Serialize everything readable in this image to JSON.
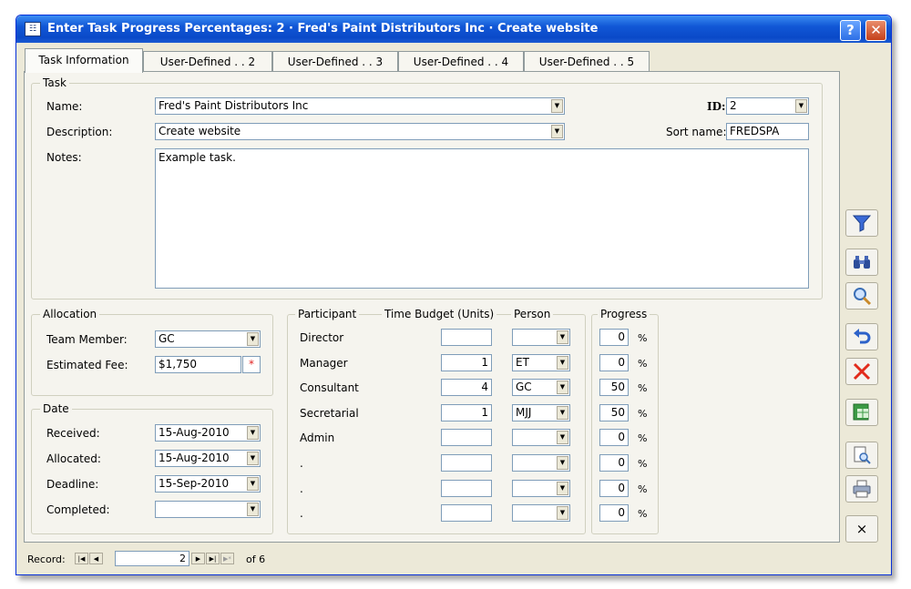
{
  "window": {
    "title": "Enter Task Progress Percentages:  2  ·  Fred's Paint Distributors Inc  ·  Create website",
    "help_label": "?",
    "close_label": "✕"
  },
  "tabs": [
    "Task Information",
    "User-Defined . . 2",
    "User-Defined . . 3",
    "User-Defined . . 4",
    "User-Defined . . 5"
  ],
  "task": {
    "group_label": "Task",
    "name_label": "Name:",
    "name_value": "Fred's Paint Distributors Inc",
    "description_label": "Description:",
    "description_value": "Create website",
    "notes_label": "Notes:",
    "notes_value": "Example task.",
    "id_label": "ID:",
    "id_value": "2",
    "sort_name_label": "Sort name:",
    "sort_name_value": "FREDSPA"
  },
  "allocation": {
    "group_label": "Allocation",
    "team_member_label": "Team Member:",
    "team_member_value": "GC",
    "estimated_fee_label": "Estimated Fee:",
    "estimated_fee_value": "$1,750",
    "fee_marker": "*"
  },
  "date": {
    "group_label": "Date",
    "received_label": "Received:",
    "received_value": "15-Aug-2010",
    "allocated_label": "Allocated:",
    "allocated_value": "15-Aug-2010",
    "deadline_label": "Deadline:",
    "deadline_value": "15-Sep-2010",
    "completed_label": "Completed:",
    "completed_value": ""
  },
  "participants": {
    "headers": {
      "participant": "Participant",
      "budget": "Time Budget (Units)",
      "person": "Person",
      "progress": "Progress"
    },
    "percent_symbol": "%",
    "rows": [
      {
        "participant": "Director",
        "budget": "",
        "person": "",
        "progress": "0"
      },
      {
        "participant": "Manager",
        "budget": "1",
        "person": "ET",
        "progress": "0"
      },
      {
        "participant": "Consultant",
        "budget": "4",
        "person": "GC",
        "progress": "50"
      },
      {
        "participant": "Secretarial",
        "budget": "1",
        "person": "MJJ",
        "progress": "50"
      },
      {
        "participant": "Admin",
        "budget": "",
        "person": "",
        "progress": "0"
      },
      {
        "participant": ".",
        "budget": "",
        "person": "",
        "progress": "0"
      },
      {
        "participant": ".",
        "budget": "",
        "person": "",
        "progress": "0"
      },
      {
        "participant": ".",
        "budget": "",
        "person": "",
        "progress": "0"
      }
    ]
  },
  "sidebar": {
    "filter_icon": "filter-icon",
    "find_icon": "binoculars-icon",
    "zoom_icon": "magnifier-icon",
    "undo_icon": "undo-icon",
    "delete_icon": "delete-icon",
    "spreadsheet_icon": "spreadsheet-icon",
    "preview_icon": "print-preview-icon",
    "print_icon": "printer-icon",
    "close_label": "×"
  },
  "status": {
    "record_label": "Record:",
    "record_value": "2",
    "of_label": "of 6",
    "first": "|◀",
    "prev": "◀",
    "next": "▶",
    "last": "▶|",
    "new": "▶*"
  }
}
